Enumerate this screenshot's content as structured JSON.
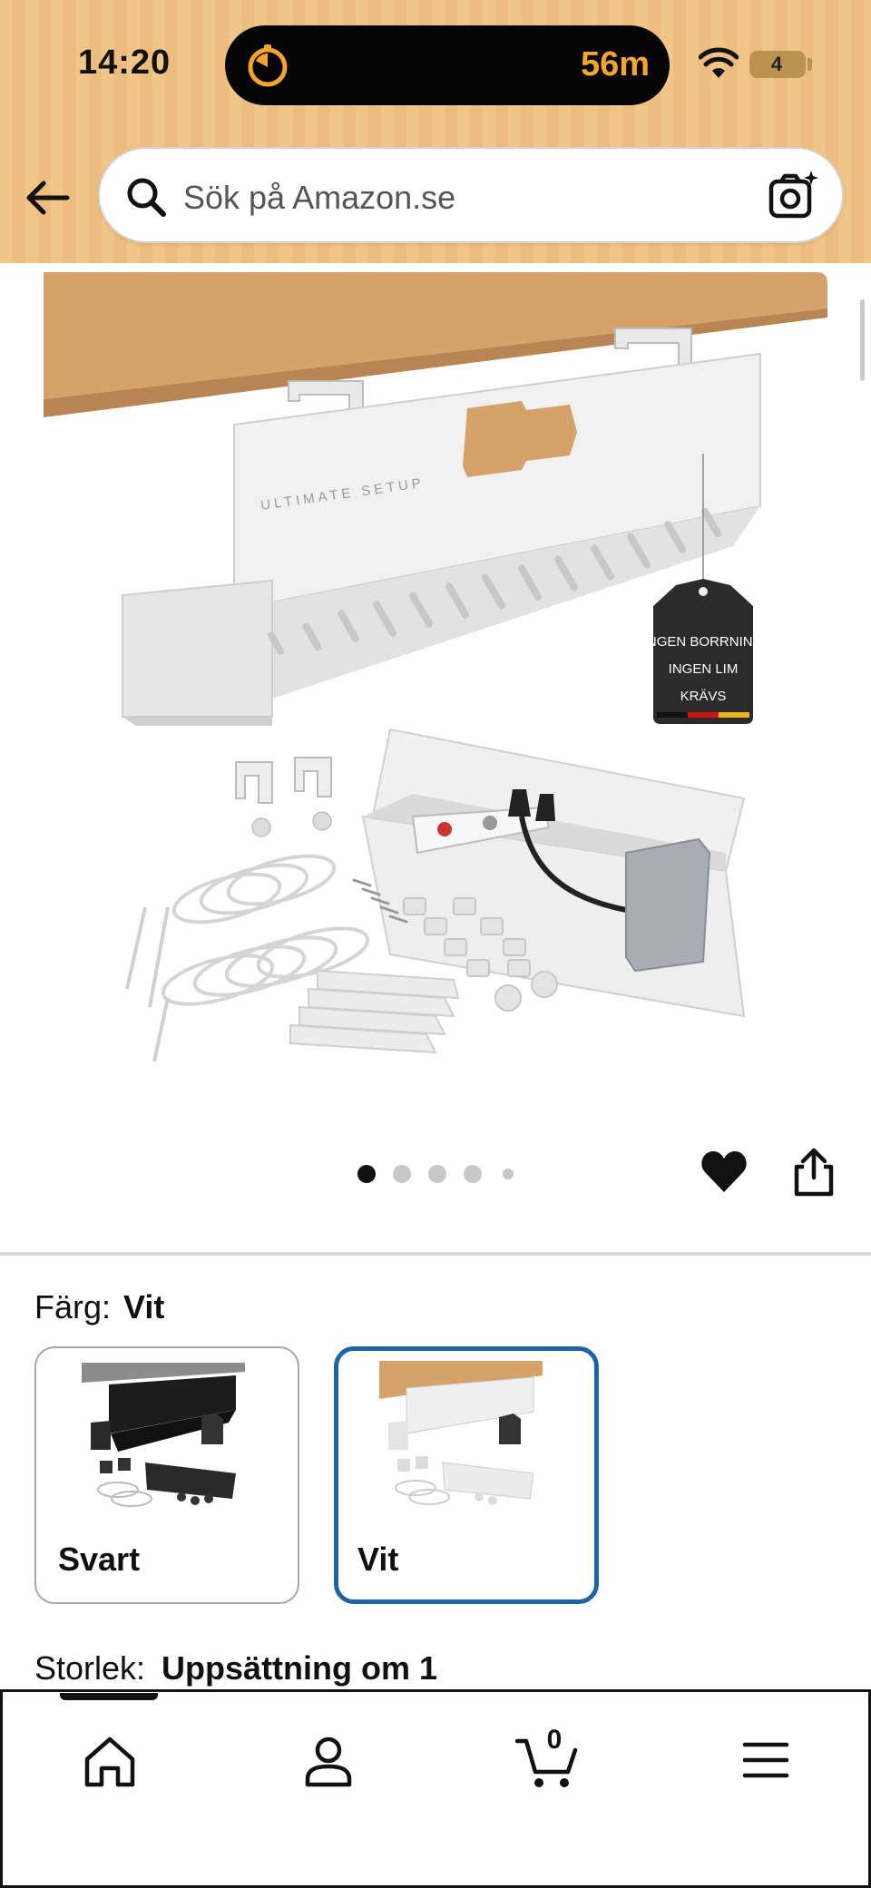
{
  "status_bar": {
    "time": "14:20",
    "live_activity_text": "56m",
    "battery_level": "4"
  },
  "search": {
    "placeholder": "Sök på Amazon.se"
  },
  "product_image": {
    "brand_text": "ULTIMATE SETUP",
    "tag_lines": [
      "INGEN BORRNING",
      "INGEN LIM",
      "KRÄVS"
    ],
    "dot_count": 5,
    "active_dot": 0
  },
  "variations": {
    "color_label": "Färg:",
    "color_value": "Vit",
    "options": [
      {
        "label": "Svart",
        "selected": false
      },
      {
        "label": "Vit",
        "selected": true
      }
    ],
    "size_label": "Storlek:",
    "size_value": "Uppsättning om 1"
  },
  "bottom_nav": {
    "cart_count": "0",
    "items": [
      "home-icon",
      "account-icon",
      "cart-icon",
      "menu-icon"
    ]
  },
  "colors": {
    "header_bg": "#f1c487",
    "selected_border": "#2162a1",
    "timer_accent": "#f5a52b"
  }
}
